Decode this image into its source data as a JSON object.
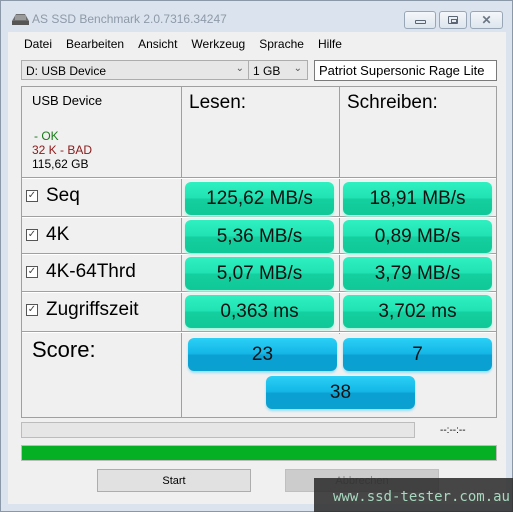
{
  "window": {
    "title": "AS SSD Benchmark 2.0.7316.34247",
    "controls": {
      "minimize": "minimize",
      "maximize": "maximize",
      "close": "close"
    }
  },
  "menu": [
    "Datei",
    "Bearbeiten",
    "Ansicht",
    "Werkzeug",
    "Sprache",
    "Hilfe"
  ],
  "toolbar": {
    "drive": "D: USB Device",
    "size": "1 GB",
    "device_label": "Patriot Supersonic Rage Lite"
  },
  "device_info": {
    "name": "USB Device",
    "status_ok": " - OK",
    "alignment": "32 K - BAD",
    "capacity": "115,62 GB"
  },
  "columns": {
    "read": "Lesen:",
    "write": "Schreiben:"
  },
  "tests": [
    {
      "label": "Seq",
      "checked": true,
      "read": "125,62 MB/s",
      "write": "18,91 MB/s"
    },
    {
      "label": "4K",
      "checked": true,
      "read": "5,36 MB/s",
      "write": "0,89 MB/s"
    },
    {
      "label": "4K-64Thrd",
      "checked": true,
      "read": "5,07 MB/s",
      "write": "3,79 MB/s"
    },
    {
      "label": "Zugriffszeit",
      "checked": true,
      "read": "0,363 ms",
      "write": "3,702 ms"
    }
  ],
  "score": {
    "label": "Score:",
    "read": "23",
    "write": "7",
    "total": "38"
  },
  "progress": {
    "timer": "--:--:--",
    "overall_fraction": 1.0
  },
  "buttons": {
    "start": "Start",
    "cancel": "Abbrechen"
  },
  "checkmark_glyph": "✓",
  "watermark": "www.ssd-tester.com.au",
  "colors": {
    "result_box": "#20e2b3",
    "score_box": "#14b6e6",
    "progress_fill": "#06b025",
    "status_ok": "#1a7a1a",
    "status_bad": "#8b1a1a"
  }
}
